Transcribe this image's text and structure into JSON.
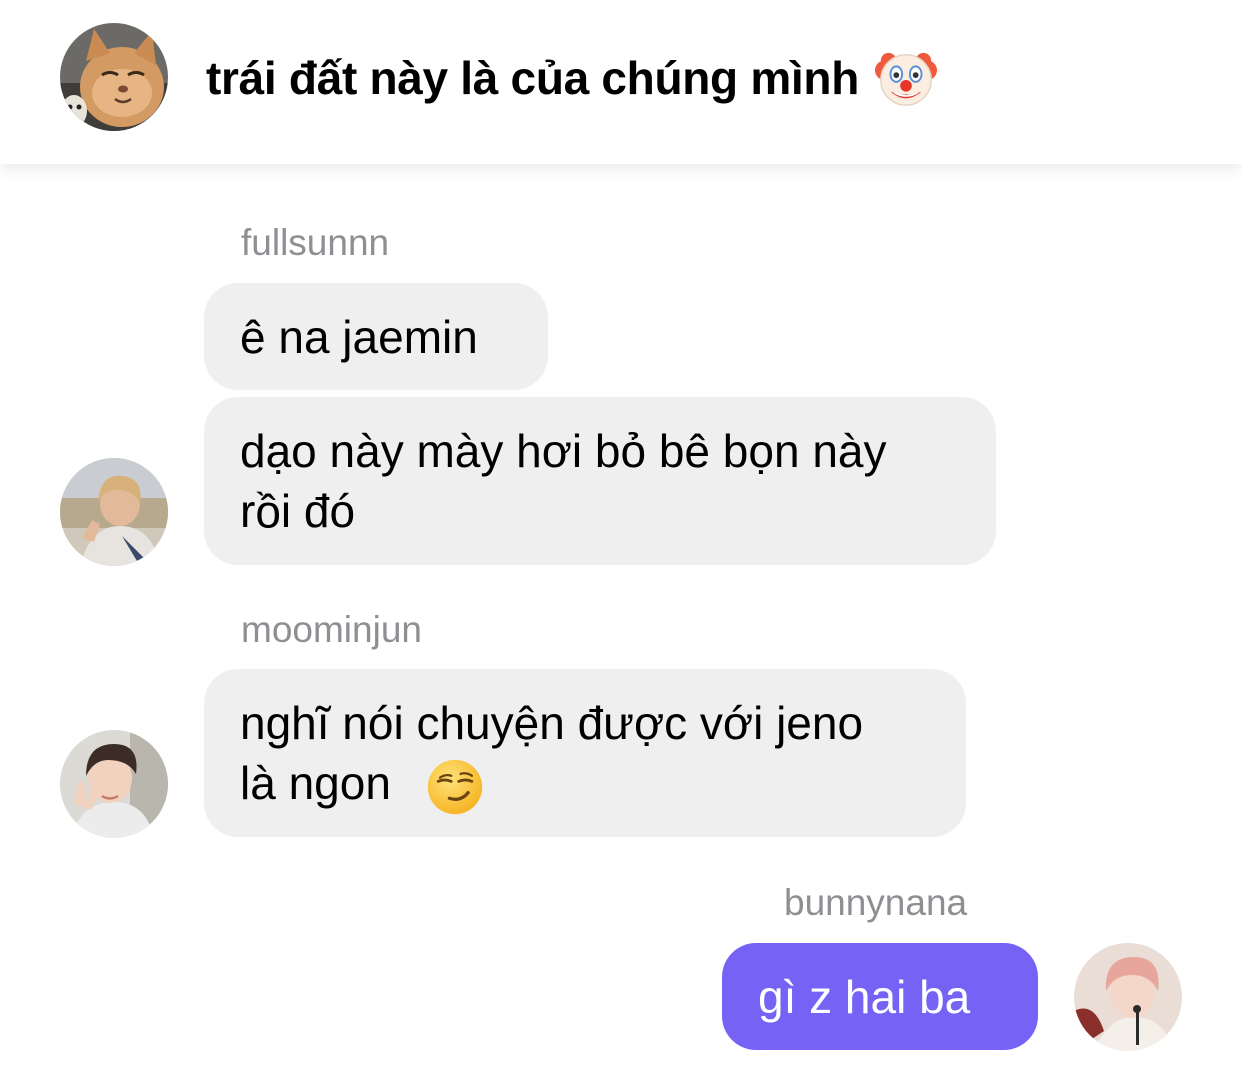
{
  "header": {
    "title": "trái đất này là của chúng mình",
    "title_emoji": "clown-face-emoji",
    "avatar": "cat-avatar"
  },
  "messages": [
    {
      "sender": "fullsunnn",
      "avatar": "user-avatar-fullsunnn",
      "bubbles": [
        "ê na jaemin",
        "dạo này mày hơi bỏ bê bọn này\nrồi đó"
      ]
    },
    {
      "sender": "moominjun",
      "avatar": "user-avatar-moominjun",
      "bubbles": [
        "nghĩ nói chuyện được với jeno\nlà ngon"
      ],
      "bubble_emoji": "smirking-face-emoji"
    },
    {
      "sender": "bunnynana",
      "avatar": "user-avatar-bunnynana",
      "bubbles": [
        "gì z hai ba"
      ]
    }
  ],
  "colors": {
    "incoming_bubble": "#efefef",
    "outgoing_bubble": "#7762f6",
    "sender_name": "#8e8e93",
    "background": "#ffffff"
  }
}
